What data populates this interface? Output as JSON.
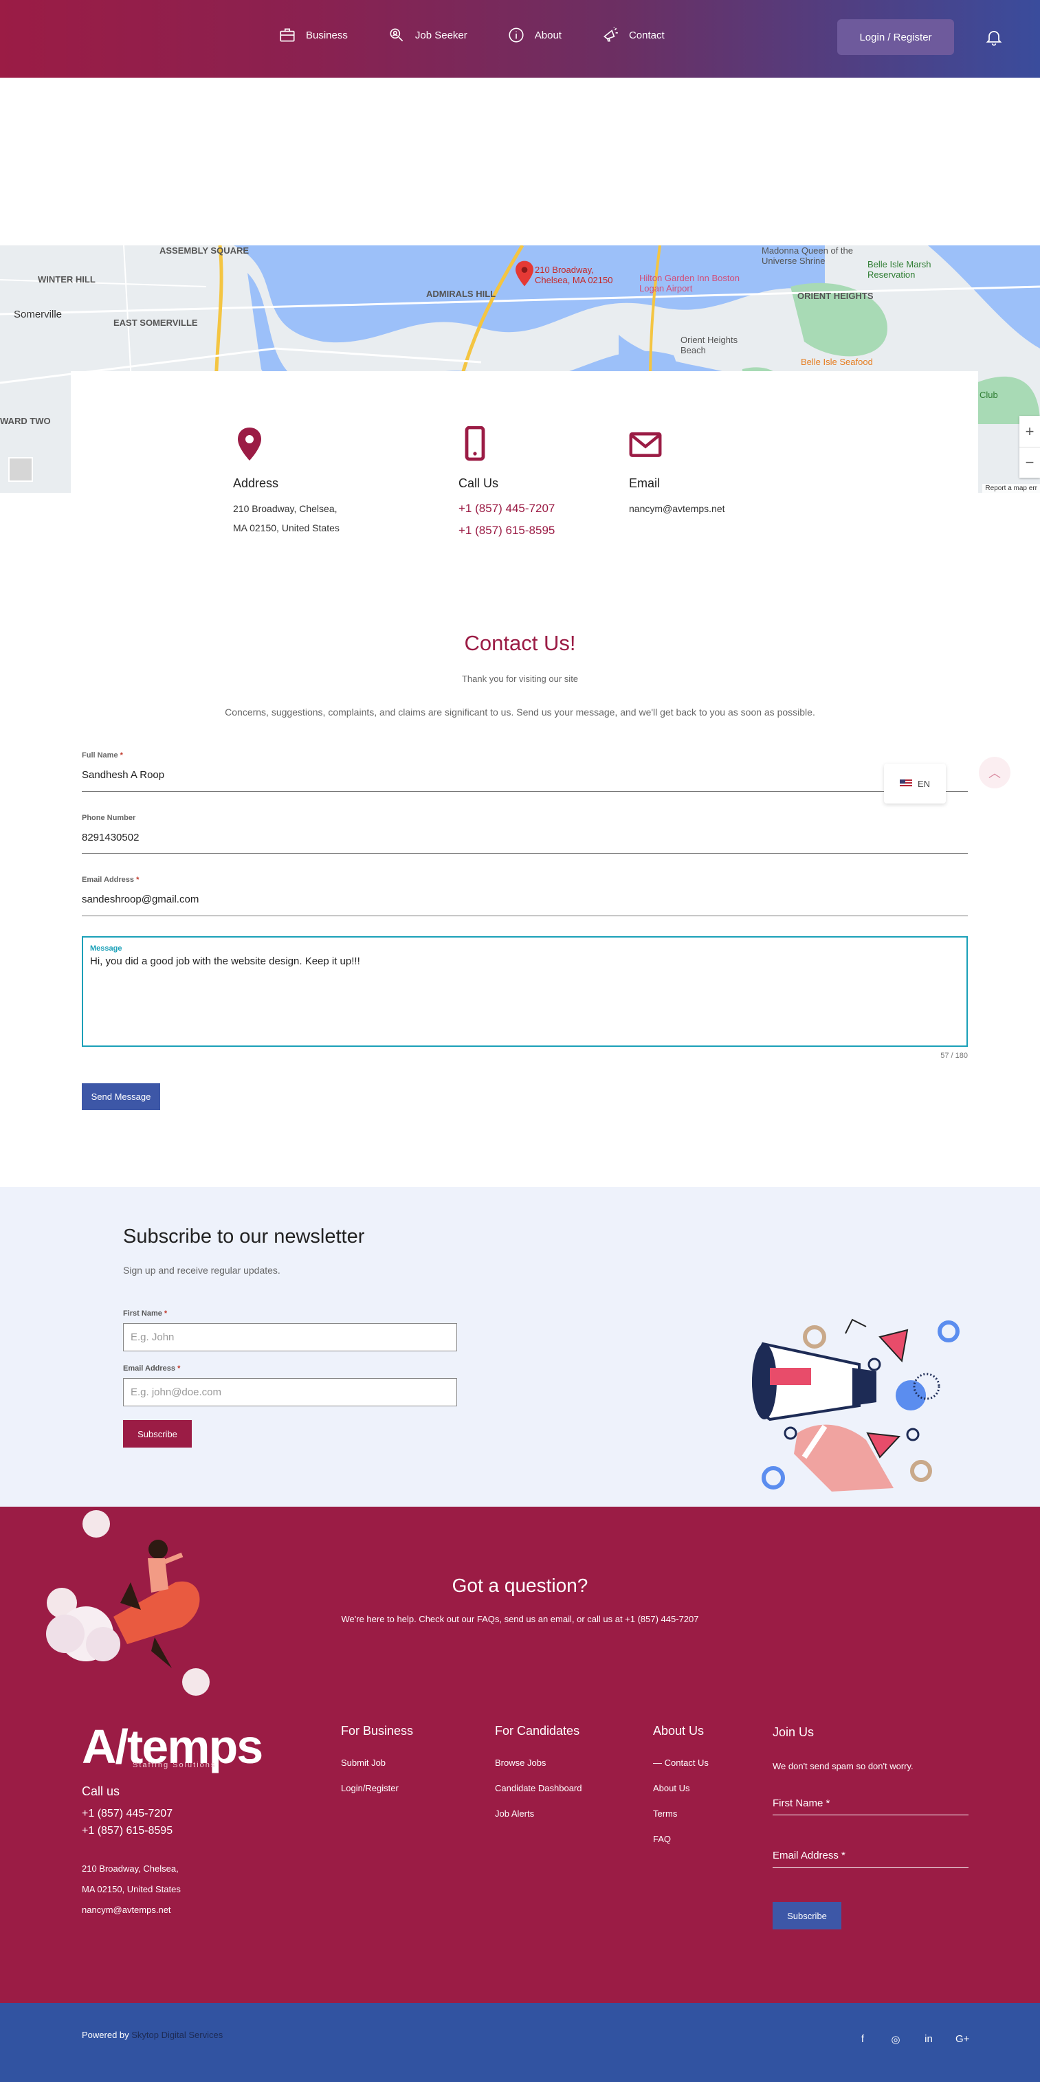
{
  "header": {
    "nav": [
      {
        "label": "Business",
        "icon": "briefcase-icon"
      },
      {
        "label": "Job Seeker",
        "icon": "search-person-icon"
      },
      {
        "label": "About",
        "icon": "info-icon"
      },
      {
        "label": "Contact",
        "icon": "megaphone-icon"
      }
    ],
    "login_label": "Login / Register"
  },
  "map": {
    "labels": [
      "ASSEMBLY SQUARE",
      "WINTER HILL",
      "Somerville",
      "EAST SOMERVILLE",
      "ADMIRALS HILL",
      "ORIENT HEIGHTS",
      "Belle Isle Marsh Reservation",
      "Madonna Queen of the Universe Shrine",
      "Hilton Garden Inn Boston Logan Airport",
      "Orient Heights Beach",
      "Belle Isle Seafood",
      "WARD TWO",
      "Club"
    ],
    "pin_label": "210 Broadway, Chelsea, MA 02150",
    "report": "Report a map err"
  },
  "info": {
    "address": {
      "title": "Address",
      "line1": "210 Broadway, Chelsea,",
      "line2": "MA 02150, United States"
    },
    "call": {
      "title": "Call Us",
      "phone1": "+1 (857) 445-7207",
      "phone2": "+1 (857) 615-8595"
    },
    "email": {
      "title": "Email",
      "value": "nancym@avtemps.net"
    }
  },
  "contact": {
    "title": "Contact Us!",
    "subtitle": "Thank you for visiting our site",
    "description": "Concerns, suggestions, complaints, and claims are significant to us. Send us your message, and we'll get back to you as soon as possible.",
    "full_name_label": "Full Name",
    "full_name": "Sandhesh A Roop",
    "phone_label": "Phone Number",
    "phone": "8291430502",
    "email_label": "Email Address",
    "email": "sandeshroop@gmail.com",
    "message_label": "Message",
    "message": "Hi, you did a good job with the website design. Keep it up!!!",
    "counter": "57 / 180",
    "send_label": "Send Message",
    "lang": "EN"
  },
  "newsletter": {
    "title": "Subscribe to our newsletter",
    "subtitle": "Sign up and receive regular updates.",
    "first_name_label": "First Name",
    "first_name_placeholder": "E.g. John",
    "email_label": "Email Address",
    "email_placeholder": "E.g. john@doe.com",
    "button": "Subscribe"
  },
  "footer": {
    "question_title": "Got a question?",
    "question_sub": "We're here to help. Check out our FAQs, send us an email, or call us at +1 (857) 445-7207",
    "logo_text": "A/temps",
    "logo_sub": "Staffing Solutions",
    "call_title": "Call us",
    "phone1": "+1 (857) 445-7207",
    "phone2": "+1 (857) 615-8595",
    "addr1": "210 Broadway, Chelsea,",
    "addr2": "MA 02150, United States",
    "email": "nancym@avtemps.net",
    "business": {
      "title": "For Business",
      "links": [
        "Submit Job",
        "Login/Register"
      ]
    },
    "candidates": {
      "title": "For Candidates",
      "links": [
        "Browse Jobs",
        "Candidate Dashboard",
        "Job Alerts"
      ]
    },
    "about": {
      "title": "About Us",
      "links": [
        "Contact Us",
        "About Us",
        "Terms",
        "FAQ"
      ]
    },
    "join": {
      "title": "Join Us",
      "note": "We don't send spam so don't worry.",
      "first_name": "First Name *",
      "email": "Email Address *",
      "button": "Subscribe"
    },
    "powered_prefix": "Powered by ",
    "powered_brand": "Skytop Digital Services",
    "socials": [
      "f",
      "◎",
      "in",
      "G+"
    ]
  },
  "colors": {
    "brand": "#9b1c45",
    "accent": "#3d57a7",
    "focus": "#1aa0b8"
  }
}
